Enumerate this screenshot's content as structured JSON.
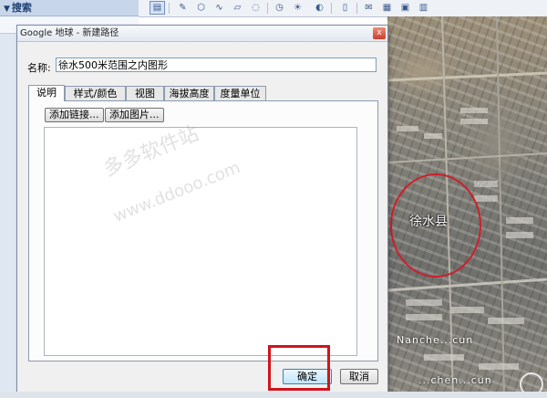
{
  "sidebar": {
    "search_header": "搜索",
    "collapse_glyph": "▼"
  },
  "toolbar": {
    "buttons": [
      {
        "icon": "sidebar-toggle-icon",
        "glyph": "▤"
      },
      {
        "icon": "placemark-icon",
        "glyph": "✎"
      },
      {
        "icon": "polygon-icon",
        "glyph": "⬡"
      },
      {
        "icon": "path-icon",
        "glyph": "∿"
      },
      {
        "icon": "overlay-icon",
        "glyph": "▱"
      },
      {
        "icon": "tour-icon",
        "glyph": "◌"
      },
      {
        "icon": "history-icon",
        "glyph": "◷"
      },
      {
        "icon": "sun-icon",
        "glyph": "☀"
      },
      {
        "icon": "planet-icon",
        "glyph": "◐"
      },
      {
        "icon": "ruler-icon",
        "glyph": "▯"
      },
      {
        "icon": "email-icon",
        "glyph": "✉"
      },
      {
        "icon": "print-icon",
        "glyph": "▦"
      },
      {
        "icon": "save-image-icon",
        "glyph": "▣"
      },
      {
        "icon": "maps-icon",
        "glyph": "▥"
      }
    ]
  },
  "dialog": {
    "title": "Google 地球 - 新建路径",
    "close_glyph": "x",
    "name_label": "名称:",
    "name_value": "徐水500米范围之内图形",
    "tabs": [
      "说明",
      "样式/颜色",
      "视图",
      "海拔高度",
      "度量单位"
    ],
    "selected_tab": "说明",
    "add_link_label": "添加链接...",
    "add_image_label": "添加图片...",
    "description_value": "",
    "ok_label": "确定",
    "cancel_label": "取消"
  },
  "map": {
    "labels": [
      "徐水县",
      "Nanche...cun",
      "...chen...cun"
    ],
    "circle_color": "#cf1f2a"
  },
  "annotation": {
    "highlight_color": "#d0141c"
  },
  "watermark": [
    "多多软件站",
    "www.ddooo.com",
    "多多软件站",
    "www.ddooo.com"
  ]
}
